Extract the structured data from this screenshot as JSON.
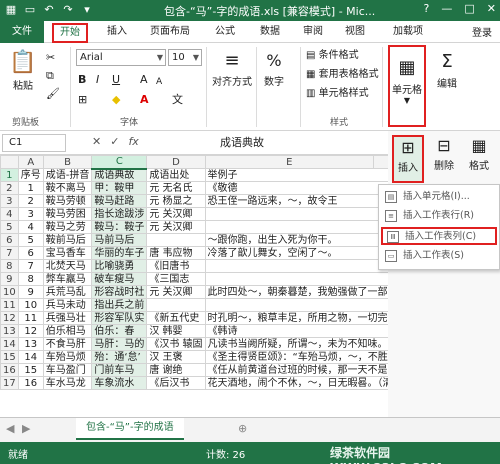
{
  "titlebar": {
    "title": "包含-“马”-字的成语.xls  [兼容模式] - Mic...",
    "qat_icons": [
      "excel-logo-icon",
      "save-icon",
      "undo-icon",
      "redo-icon",
      "touch-mode-icon"
    ],
    "help": "?",
    "minimize": "—",
    "restore": "□",
    "close": "✕",
    "brand_color": "#217346"
  },
  "tabs": {
    "file": "文件",
    "home": "开始",
    "insert": "插入",
    "page_layout": "页面布局",
    "formulas": "公式",
    "data": "数据",
    "review": "审阅",
    "view": "视图",
    "addins": "加载项",
    "login": "登录"
  },
  "ribbon": {
    "clipboard": {
      "paste": "粘贴",
      "label": "剪贴板"
    },
    "font": {
      "name": "Arial",
      "size": "10",
      "bold": "B",
      "italic": "I",
      "underline": "U",
      "grow": "A",
      "shrink": "A",
      "label": "字体"
    },
    "alignment": {
      "label": "对齐方式"
    },
    "number": {
      "label": "数字",
      "percent": "%"
    },
    "styles": {
      "conditional": "条件格式",
      "table_format": "套用表格格式",
      "cell_styles": "单元格样式",
      "label": "样式"
    },
    "cells": {
      "label": "单元格"
    },
    "editing": {
      "label": "编辑"
    }
  },
  "formula_bar": {
    "name_box": "C1",
    "cancel": "✕",
    "enter": "✓",
    "fx": "fx",
    "content": "成语典故"
  },
  "grid": {
    "columns": [
      "A",
      "B",
      "C",
      "D",
      "E",
      "F",
      "G"
    ],
    "selected_column": "C",
    "rows": [
      {
        "n": "1",
        "a": "序号",
        "b": "成语-拼音",
        "c": "成语典故",
        "d": "成语出处",
        "e": "举例子"
      },
      {
        "n": "2",
        "a": "1",
        "b": "鞍不离马",
        "c": "甲：鞍甲",
        "d": "元 无名氏",
        "e": "《敬德"
      },
      {
        "n": "3",
        "a": "2",
        "b": "鞍马劳顿",
        "c": "鞍马赶路",
        "d": "元 杨显之",
        "e": "恐王侄一路远来，～，故令王"
      },
      {
        "n": "4",
        "a": "3",
        "b": "鞍马劳困",
        "c": "指长途跋涉",
        "d": "元 关汉卿",
        "e": ""
      },
      {
        "n": "5",
        "a": "4",
        "b": "鞍马之劳",
        "c": "鞍马：鞍子",
        "d": "元 关汉卿",
        "e": ""
      },
      {
        "n": "6",
        "a": "5",
        "b": "鞍前马后",
        "c": "马前马后",
        "d": "",
        "e": "～跟你跑，出生入死为你干。"
      },
      {
        "n": "7",
        "a": "6",
        "b": "宝马香车",
        "c": "华丽的车子",
        "d": "唐 韦应物",
        "e": "冷落了歆儿舞女，空闲了～。"
      },
      {
        "n": "8",
        "a": "7",
        "b": "北焚天马",
        "c": "比喻骁勇",
        "d": "《旧唐书",
        "e": ""
      },
      {
        "n": "9",
        "a": "8",
        "b": "弊车羸马",
        "c": "破车瘦马",
        "d": "《三国志",
        "e": ""
      },
      {
        "n": "10",
        "a": "9",
        "b": "兵荒马乱",
        "c": "形容战时社",
        "d": "元 关汉卿",
        "e": "此时四处～，朝秦暮楚，我勉强做了一部《旧唐书》"
      },
      {
        "n": "11",
        "a": "10",
        "b": "兵马未动",
        "c": "指出兵之前",
        "d": "",
        "e": ""
      },
      {
        "n": "12",
        "a": "11",
        "b": "兵强马壮",
        "c": "形容军队实",
        "d": "《新五代史",
        "e": "时孔明～，粮草丰足，所用之物，一切完备，正要出"
      },
      {
        "n": "13",
        "a": "12",
        "b": "伯乐相马",
        "c": "伯乐：春",
        "d": "汉 韩婴",
        "e": "《韩诗"
      },
      {
        "n": "14",
        "a": "13",
        "b": "不食马肝",
        "c": "马肝：马的",
        "d": "《汉书 辕固",
        "e": "凡读书当阙所疑，所谓～，未为不知味。（清 刘熙"
      },
      {
        "n": "15",
        "a": "14",
        "b": "车殆马烦",
        "c": "殆：通‘怠’",
        "d": "汉 王褒",
        "e": "《圣主得贤臣颂》：“车殆马烦，～，不胜困惫。（清 纪昀《阅微草堂笔"
      },
      {
        "n": "16",
        "a": "15",
        "b": "车马盈门",
        "c": "门前车马",
        "d": "唐 谢绝",
        "e": "《任从前黄道台过班的时候，那一天不是～，还有多少"
      },
      {
        "n": "17",
        "a": "16",
        "b": "车水马龙",
        "c": "车象流水",
        "d": "《后汉书",
        "e": "花天酒地，闹个不休，～，日无暇晷。（清 吴趼人"
      }
    ]
  },
  "cells_menu": {
    "insert_label": "插入",
    "delete_label": "删除",
    "format_label": "格式",
    "items": [
      "插入单元格(I)...",
      "插入工作表行(R)",
      "插入工作表列(C)",
      "插入工作表(S)"
    ],
    "highlighted_index": 2
  },
  "sheet_tabs": {
    "active": "包含-“马”-字的成语",
    "add": "⊕"
  },
  "status": {
    "ready": "就绪",
    "count": "计数: 26",
    "watermark": "绿茶软件园  WWW.33LC.COM"
  },
  "colors": {
    "accent": "#217346",
    "highlight_red": "#e02020",
    "selected_col_bg": "#e1efe6"
  }
}
